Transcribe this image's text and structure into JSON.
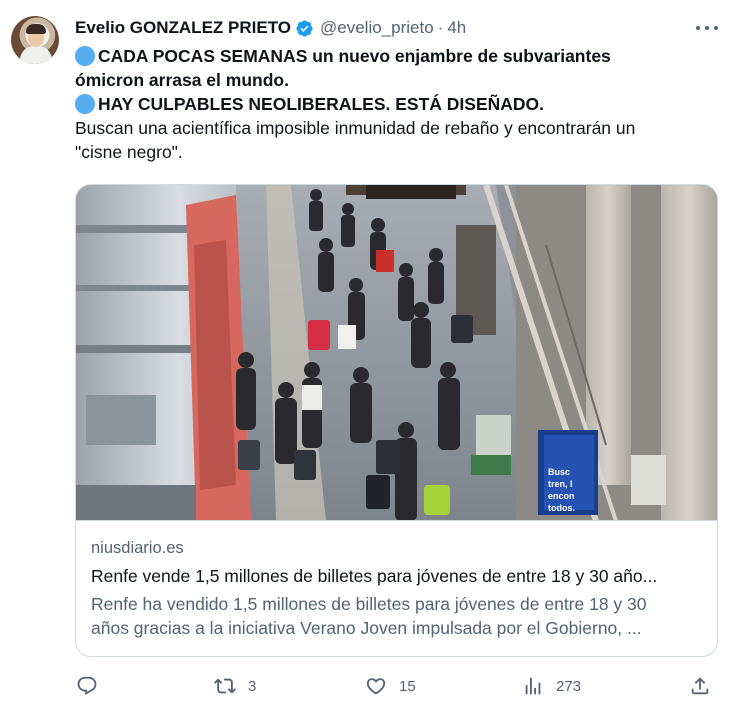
{
  "author": {
    "name": "Evelio GONZALEZ PRIETO",
    "handle": "@evelio_prieto",
    "separator": "·",
    "time": "4h",
    "verified": true
  },
  "tweet": {
    "line1": "CADA POCAS SEMANAS un nuevo enjambre de subvariantes",
    "line2": "ómicron arrasa el mundo.",
    "line3": "HAY CULPABLES NEOLIBERALES. ESTÁ DISEÑADO.",
    "line4": "Buscan una acientífica imposible inmunidad de rebaño y encontrarán un",
    "line5": "\"cisne negro\"."
  },
  "card": {
    "domain": "niusdiario.es",
    "title": "Renfe vende 1,5 millones de billetes para jóvenes de entre 18 y 30 año...",
    "desc_line1": "Renfe ha vendido 1,5 millones de billetes para jóvenes de entre 18 y 30",
    "desc_line2": "años gracias a la iniciativa Verano Joven impulsada por el Gobierno, ...",
    "image_sign_text": "Busc tren, l encon todos."
  },
  "actions": {
    "reply_count": "",
    "retweet_count": "3",
    "like_count": "15",
    "views_count": "273"
  },
  "colors": {
    "text": "#0f1419",
    "muted": "#536471",
    "verified": "#1d9bf0",
    "emoji_dot": "#55acee",
    "border": "#cfd9de"
  },
  "icons": [
    "verified-badge-icon",
    "more-icon",
    "reply-icon",
    "retweet-icon",
    "like-icon",
    "views-icon",
    "share-icon"
  ]
}
